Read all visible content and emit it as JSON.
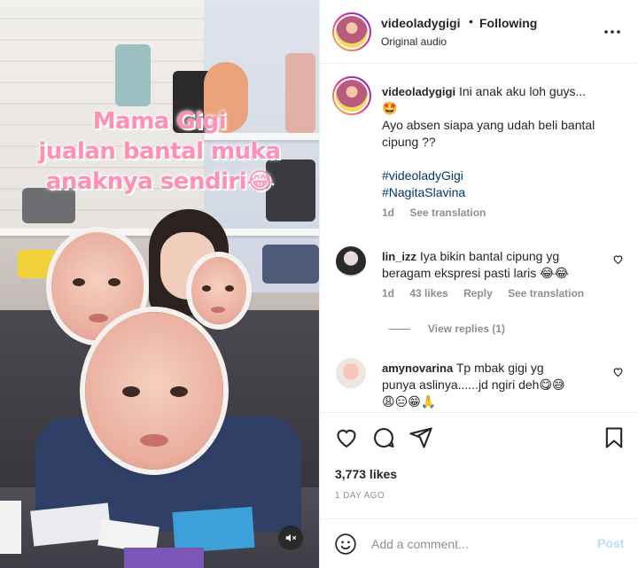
{
  "media": {
    "overlay_lines": [
      "Mama Gigi",
      "jualan bantal muka",
      "anaknya sendiri😂"
    ],
    "mute_icon": "speaker-muted-icon"
  },
  "header": {
    "username": "videoladygigi",
    "separator": "•",
    "follow_status": "Following",
    "audio": "Original audio",
    "more_icon": "more-options-icon"
  },
  "caption": {
    "username": "videoladygigi",
    "line1": "Ini anak aku loh guys...",
    "line2": "🤩",
    "line3": "Ayo absen siapa yang udah beli bantal",
    "line4": "cipung ??",
    "hashtag1": "#videoladyGigi",
    "hashtag2": "#NagitaSlavina",
    "time": "1d",
    "translate": "See translation"
  },
  "comments": [
    {
      "username": "lin_izz",
      "text_line1": "Iya bikin bantal cipung yg",
      "text_line2": "beragam ekspresi pasti laris 😂😂",
      "time": "1d",
      "likes": "43 likes",
      "reply": "Reply",
      "translate": "See translation",
      "view_replies": "View replies (1)"
    },
    {
      "username": "amynovarina",
      "text_line1": "Tp mbak gigi yg",
      "text_line2": "punya aslinya......jd ngiri deh😋😅",
      "text_line3": "😩😑😁🙏"
    }
  ],
  "actions": {
    "likes": "3,773 likes",
    "time_ago": "1 DAY AGO"
  },
  "add_comment": {
    "placeholder": "Add a comment...",
    "post_label": "Post"
  },
  "colors": {
    "link": "#00376b",
    "muted": "#8e8e8e",
    "post_disabled": "#b2dffc",
    "overlay_pink": "#ff8fb5"
  }
}
